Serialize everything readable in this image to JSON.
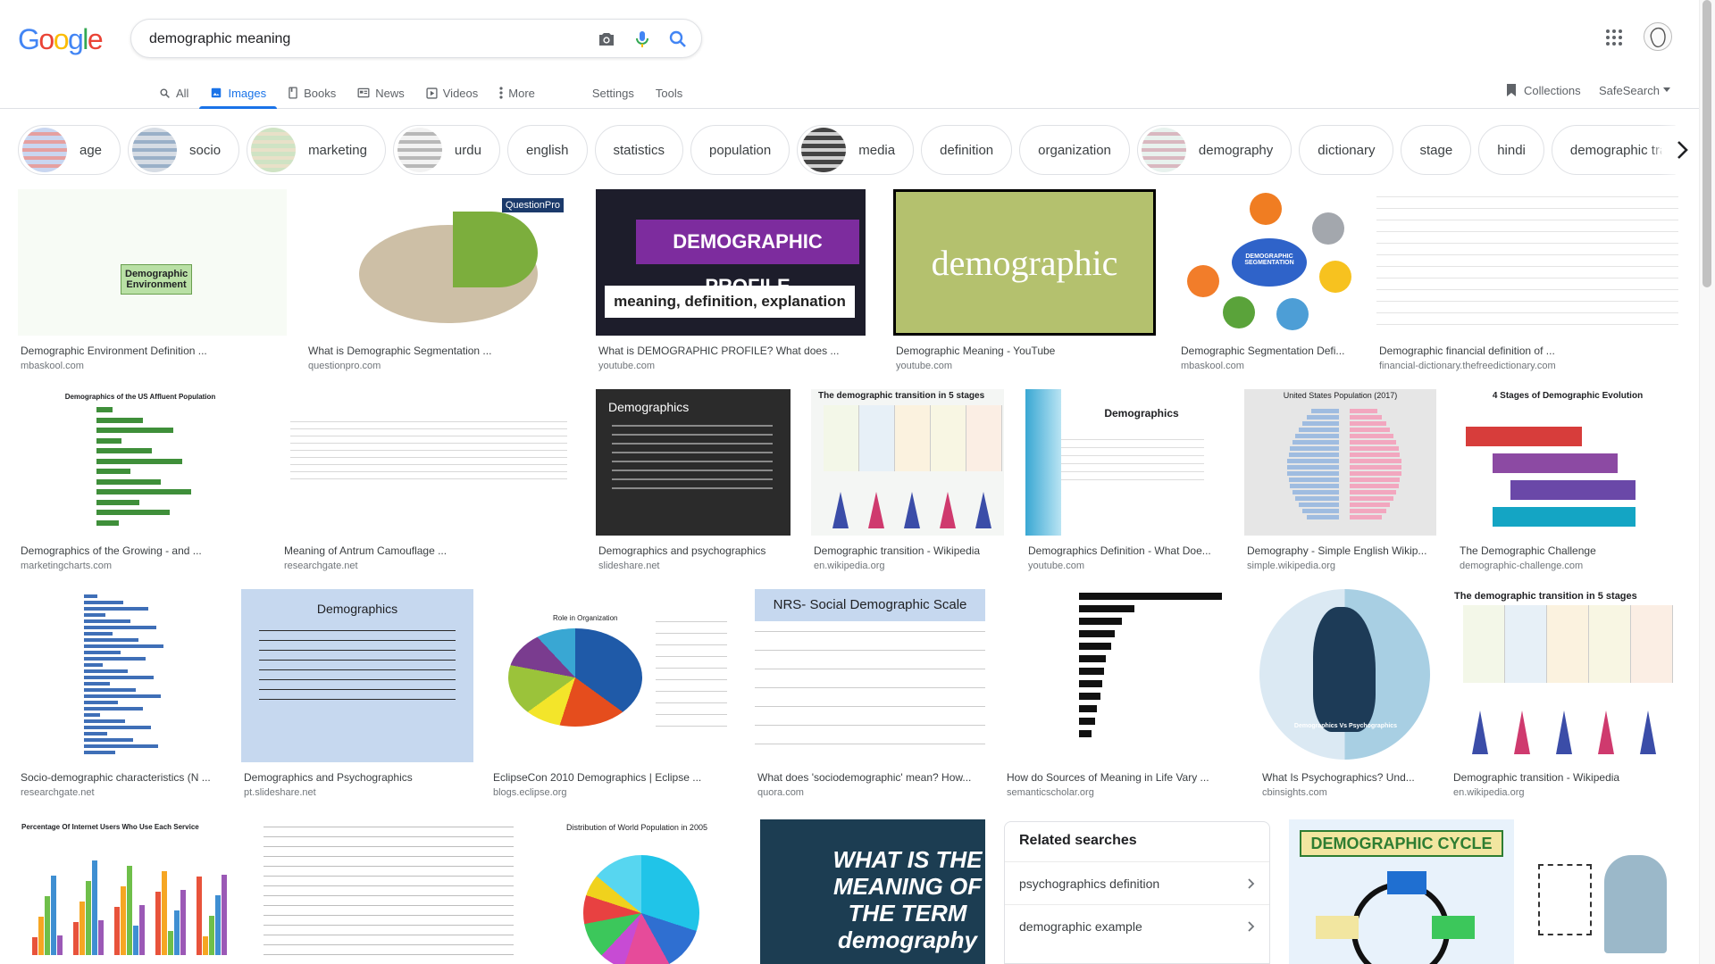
{
  "search": {
    "query": "demographic meaning",
    "logo_letters": [
      {
        "ch": "G",
        "color": "#4285F4"
      },
      {
        "ch": "o",
        "color": "#EA4335"
      },
      {
        "ch": "o",
        "color": "#FBBC05"
      },
      {
        "ch": "g",
        "color": "#4285F4"
      },
      {
        "ch": "l",
        "color": "#34A853"
      },
      {
        "ch": "e",
        "color": "#EA4335"
      }
    ]
  },
  "tabs": {
    "all": "All",
    "images": "Images",
    "books": "Books",
    "news": "News",
    "videos": "Videos",
    "more": "More",
    "settings": "Settings",
    "tools": "Tools"
  },
  "right_tools": {
    "collections": "Collections",
    "safesearch": "SafeSearch"
  },
  "chips": [
    {
      "label": "age",
      "thumb": true
    },
    {
      "label": "socio",
      "thumb": true
    },
    {
      "label": "marketing",
      "thumb": true
    },
    {
      "label": "urdu",
      "thumb": true
    },
    {
      "label": "english",
      "thumb": false
    },
    {
      "label": "statistics",
      "thumb": false
    },
    {
      "label": "population",
      "thumb": false
    },
    {
      "label": "media",
      "thumb": true
    },
    {
      "label": "definition",
      "thumb": false
    },
    {
      "label": "organization",
      "thumb": false
    },
    {
      "label": "demography",
      "thumb": true
    },
    {
      "label": "dictionary",
      "thumb": false
    },
    {
      "label": "stage",
      "thumb": false
    },
    {
      "label": "hindi",
      "thumb": false
    },
    {
      "label": "demographic transition stag",
      "thumb": false
    }
  ],
  "results": [
    {
      "title": "Demographic Environment Definition ...",
      "source": "mbaskool.com",
      "img_text": "Demographic Environment"
    },
    {
      "title": "What is Demographic Segmentation ...",
      "source": "questionpro.com",
      "img_text": "QuestionPro"
    },
    {
      "title": "What is DEMOGRAPHIC PROFILE? What does ...",
      "source": "youtube.com",
      "img_text": "DEMOGRAPHIC PROFILE",
      "img_sub": "meaning, definition, explanation"
    },
    {
      "title": "Demographic Meaning - YouTube",
      "source": "youtube.com",
      "img_text": "demographic"
    },
    {
      "title": "Demographic Segmentation Defi...",
      "source": "mbaskool.com",
      "img_text": "DEMOGRAPHIC SEGMENTATION"
    },
    {
      "title": "Demographic financial definition of ...",
      "source": "financial-dictionary.thefreedictionary.com",
      "img_text": ""
    },
    {
      "title": "Demographics of the Growing - and ...",
      "source": "marketingcharts.com",
      "img_text": "Demographics of the US Affluent Population"
    },
    {
      "title": "Meaning of Antrum Camouflage ...",
      "source": "researchgate.net",
      "img_text": ""
    },
    {
      "title": "Demographics and psychographics",
      "source": "slideshare.net",
      "img_text": "Demographics"
    },
    {
      "title": "Demographic transition - Wikipedia",
      "source": "en.wikipedia.org",
      "img_text": "The demographic transition in 5 stages"
    },
    {
      "title": "Demographics Definition - What Doe...",
      "source": "youtube.com",
      "img_text": "Demographics"
    },
    {
      "title": "Demography - Simple English Wikip...",
      "source": "simple.wikipedia.org",
      "img_text": "United States Population (2017)"
    },
    {
      "title": "The Demographic Challenge",
      "source": "demographic-challenge.com",
      "img_text": "4 Stages of Demographic Evolution"
    },
    {
      "title": "Socio-demographic characteristics (N ...",
      "source": "researchgate.net",
      "img_text": ""
    },
    {
      "title": "Demographics and Psychographics",
      "source": "pt.slideshare.net",
      "img_text": "Demographics"
    },
    {
      "title": "EclipseCon 2010 Demographics | Eclipse ...",
      "source": "blogs.eclipse.org",
      "img_text": "Role in Organization"
    },
    {
      "title": "What does 'sociodemographic' mean? How...",
      "source": "quora.com",
      "img_text": "NRS- Social Demographic Scale"
    },
    {
      "title": "How do Sources of Meaning in Life Vary ...",
      "source": "semanticscholar.org",
      "img_text": ""
    },
    {
      "title": "What Is Psychographics? Und...",
      "source": "cbinsights.com",
      "img_text": "Demographics Vs Psychographics"
    },
    {
      "title": "Demographic transition - Wikipedia",
      "source": "en.wikipedia.org",
      "img_text": "The demographic transition in 5 stages"
    },
    {
      "title": "",
      "source": "",
      "img_text": "Percentage Of Internet Users Who Use Each Service"
    },
    {
      "title": "",
      "source": "",
      "img_text": ""
    },
    {
      "title": "",
      "source": "",
      "img_text": "Distribution of World Population in 2005"
    },
    {
      "title": "",
      "source": "",
      "img_text": "WHAT IS THE MEANING OF THE TERM demography"
    },
    {
      "title": "",
      "source": "",
      "img_text": "DEMOGRAPHIC CYCLE"
    },
    {
      "title": "",
      "source": "",
      "img_text": ""
    }
  ],
  "related": {
    "heading": "Related searches",
    "items": [
      "psychographics definition",
      "demographic example"
    ]
  }
}
